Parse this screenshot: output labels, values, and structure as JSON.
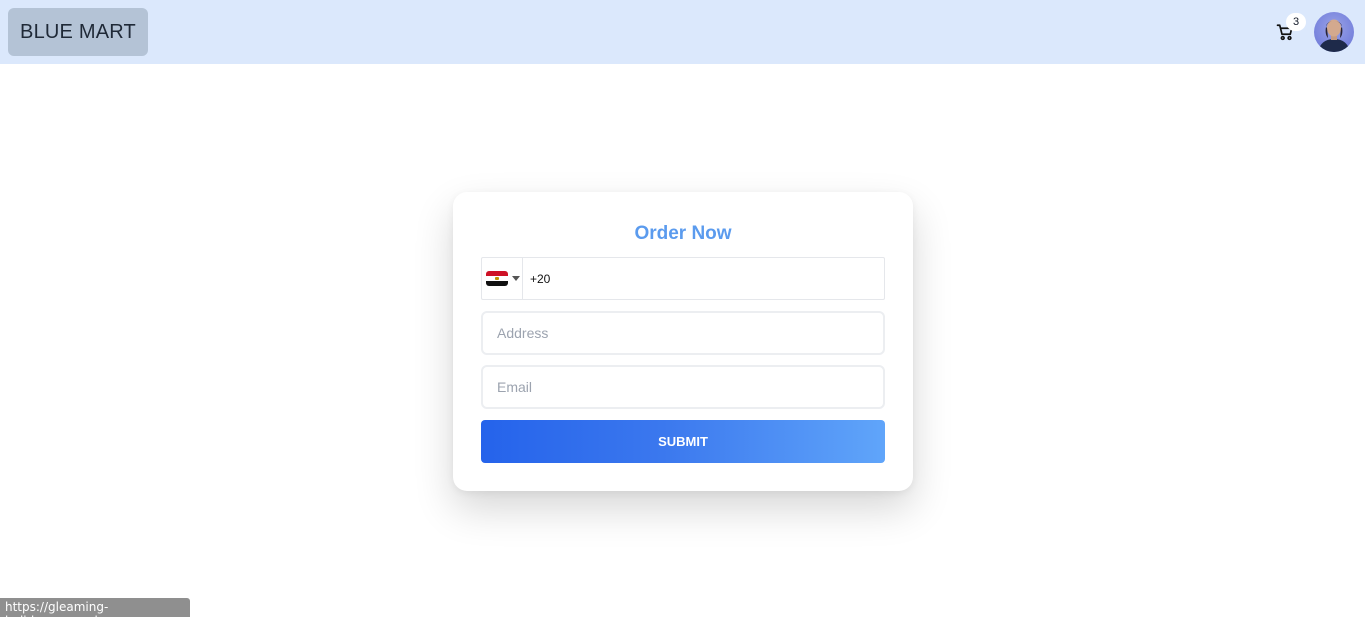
{
  "navbar": {
    "brand": "BLUE MART",
    "cart_count": "3",
    "cart_icon": "cart-icon",
    "avatar": "user-avatar"
  },
  "order_form": {
    "title": "Order Now",
    "phone": {
      "country_flag": "egypt-flag-icon",
      "value": "+20"
    },
    "address_placeholder": "Address",
    "email_placeholder": "Email",
    "submit_label": "SUBMIT"
  },
  "status_bar": {
    "url": "https://gleaming-holiday.surge.sh"
  },
  "colors": {
    "navbar_bg": "#dbe8fc",
    "brand_bg": "#b4c3d6",
    "title": "#5b9bee",
    "button_start": "#2563eb",
    "button_end": "#60a5fa"
  }
}
